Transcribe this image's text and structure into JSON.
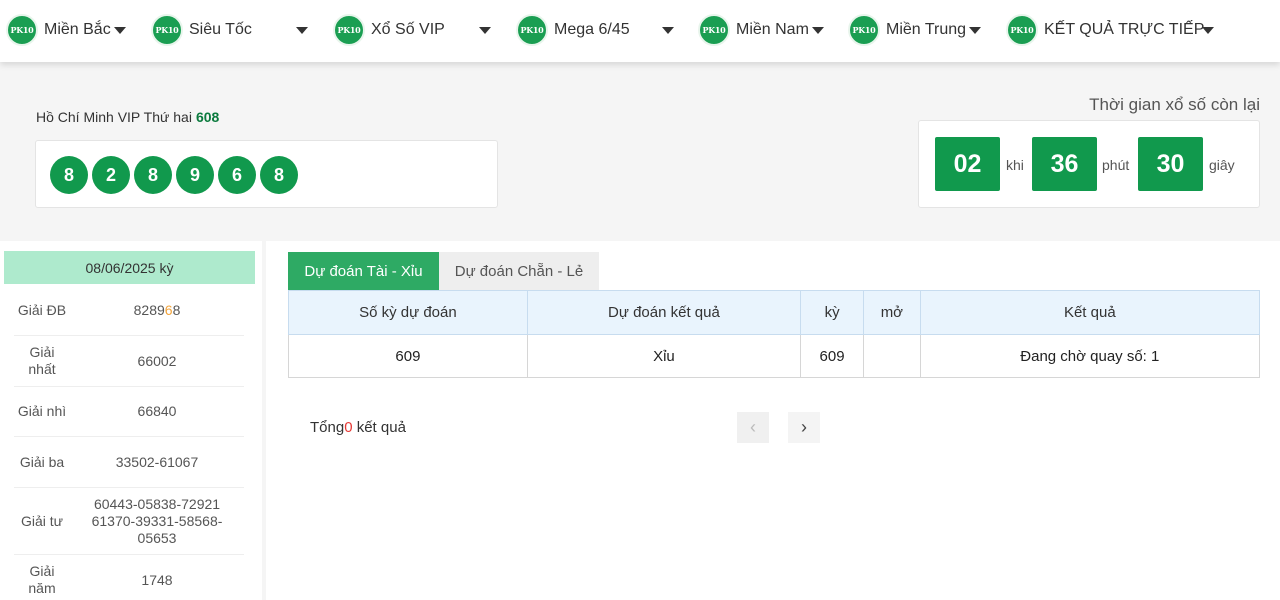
{
  "nav": {
    "logo_text": "PK10",
    "items": [
      {
        "label": "Miền Bắc"
      },
      {
        "label": "Siêu Tốc"
      },
      {
        "label": "Xổ Số VIP"
      },
      {
        "label": "Mega 6/45"
      },
      {
        "label": "Miền Nam"
      },
      {
        "label": "Miền Trung"
      },
      {
        "label": "KẾT QUẢ TRỰC TIẾP"
      }
    ]
  },
  "draw": {
    "title": "Hồ Chí Minh VIP Thứ hai",
    "period": "608",
    "balls": [
      "8",
      "2",
      "8",
      "9",
      "6",
      "8"
    ]
  },
  "countdown": {
    "label": "Thời gian xổ số còn lại",
    "hours": "02",
    "hours_unit": "khi",
    "minutes": "36",
    "minutes_unit": "phút",
    "seconds": "30",
    "seconds_unit": "giây"
  },
  "results": {
    "header": "08/06/2025 kỳ",
    "rows": [
      {
        "name": "Giải ĐB",
        "value_prefix": "8289",
        "value_highlight": "6",
        "value_suffix": "8"
      },
      {
        "name": "Giải nhất",
        "value": "66002"
      },
      {
        "name": "Giải nhì",
        "value": "66840"
      },
      {
        "name": "Giải ba",
        "value": "33502-61067"
      },
      {
        "name": "Giải tư",
        "value": "60443-05838-72921 61370-39331-58568-05653"
      },
      {
        "name": "Giải năm",
        "value": "1748"
      }
    ]
  },
  "tabs": [
    {
      "label": "Dự đoán Tài - Xỉu",
      "active": true
    },
    {
      "label": "Dự đoán Chẵn - Lẻ",
      "active": false
    }
  ],
  "table": {
    "headers": [
      "Số kỳ dự đoán",
      "Dự đoán kết quả",
      "kỳ",
      "mở",
      "Kết quả"
    ],
    "rows": [
      [
        "609",
        "Xỉu",
        "609",
        "",
        "Đang chờ quay số: 1"
      ]
    ]
  },
  "pagination": {
    "total_prefix": "Tổng",
    "total_count": "0",
    "total_suffix": " kết quả",
    "prev_icon": "‹",
    "next_icon": "›"
  },
  "colors": {
    "brand_green": "#11994d",
    "tab_active": "#2eaa64",
    "highlight": "#f2a33a",
    "count_red": "#e53935"
  }
}
